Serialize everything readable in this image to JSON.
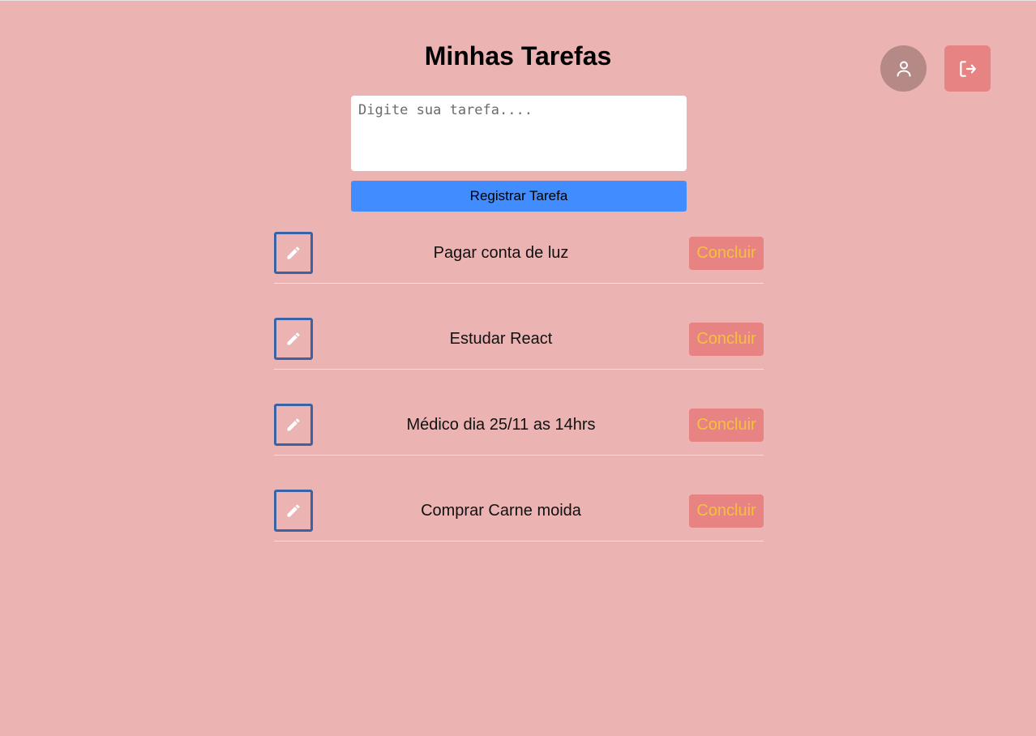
{
  "header": {
    "title": "Minhas Tarefas",
    "profile_icon": "user-icon",
    "logout_icon": "logout-icon"
  },
  "form": {
    "placeholder": "Digite sua tarefa....",
    "value": "",
    "submit_label": "Registrar Tarefa"
  },
  "tasks": [
    {
      "text": "Pagar conta de luz",
      "action_label": "Concluir"
    },
    {
      "text": "Estudar React",
      "action_label": "Concluir"
    },
    {
      "text": "Médico dia 25/11 as 14hrs",
      "action_label": "Concluir"
    },
    {
      "text": "Comprar Carne moida",
      "action_label": "Concluir"
    }
  ],
  "colors": {
    "background": "#ebb3b2",
    "register_button": "#418cff",
    "conclude_button": "#e78383",
    "conclude_text": "#f4c23a",
    "edit_border": "#3a63a6",
    "profile_button": "#b58986",
    "logout_button": "#e78383"
  },
  "icons": {
    "edit": "pencil-icon"
  }
}
